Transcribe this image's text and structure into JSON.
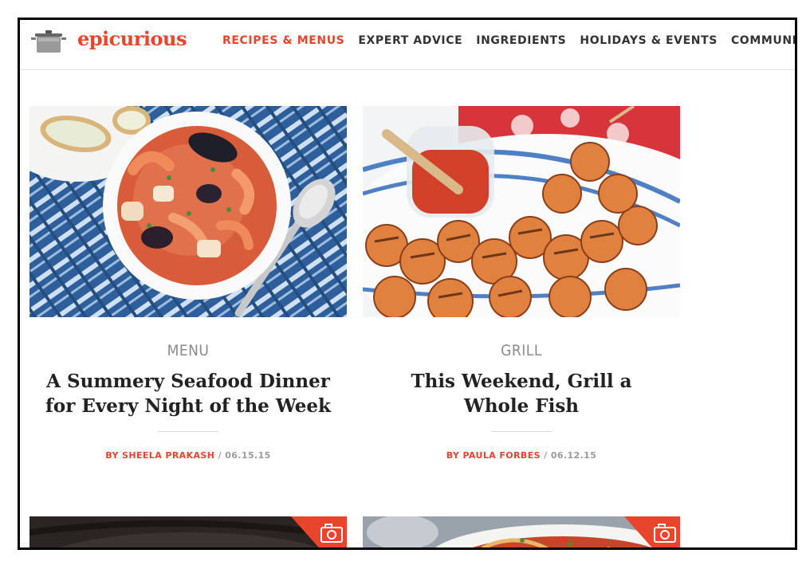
{
  "brand": {
    "name": "epicurious",
    "color": "#e8452c"
  },
  "nav": {
    "items": [
      {
        "label": "RECIPES & MENUS",
        "active": true
      },
      {
        "label": "EXPERT ADVICE",
        "active": false
      },
      {
        "label": "INGREDIENTS",
        "active": false
      },
      {
        "label": "HOLIDAYS & EVENTS",
        "active": false
      },
      {
        "label": "COMMUNITY",
        "active": false
      }
    ]
  },
  "cards": [
    {
      "category": "MENU",
      "title": "A Summery Seafood Dinner for Every Night of the Week",
      "author": "BY SHEELA PRAKASH",
      "date": " / 06.15.15",
      "image": "seafood-stew-bowl"
    },
    {
      "category": "GRILL",
      "title": "This Weekend, Grill a Whole Fish",
      "author": "BY PAULA FORBES",
      "date": " / 06.12.15",
      "image": "grilled-shrimp-skewers"
    }
  ],
  "bottom_cards": [
    {
      "image": "pan-dish",
      "badge_icon": "camera-icon"
    },
    {
      "image": "spaghetti-dish",
      "badge_icon": "camera-icon"
    }
  ]
}
